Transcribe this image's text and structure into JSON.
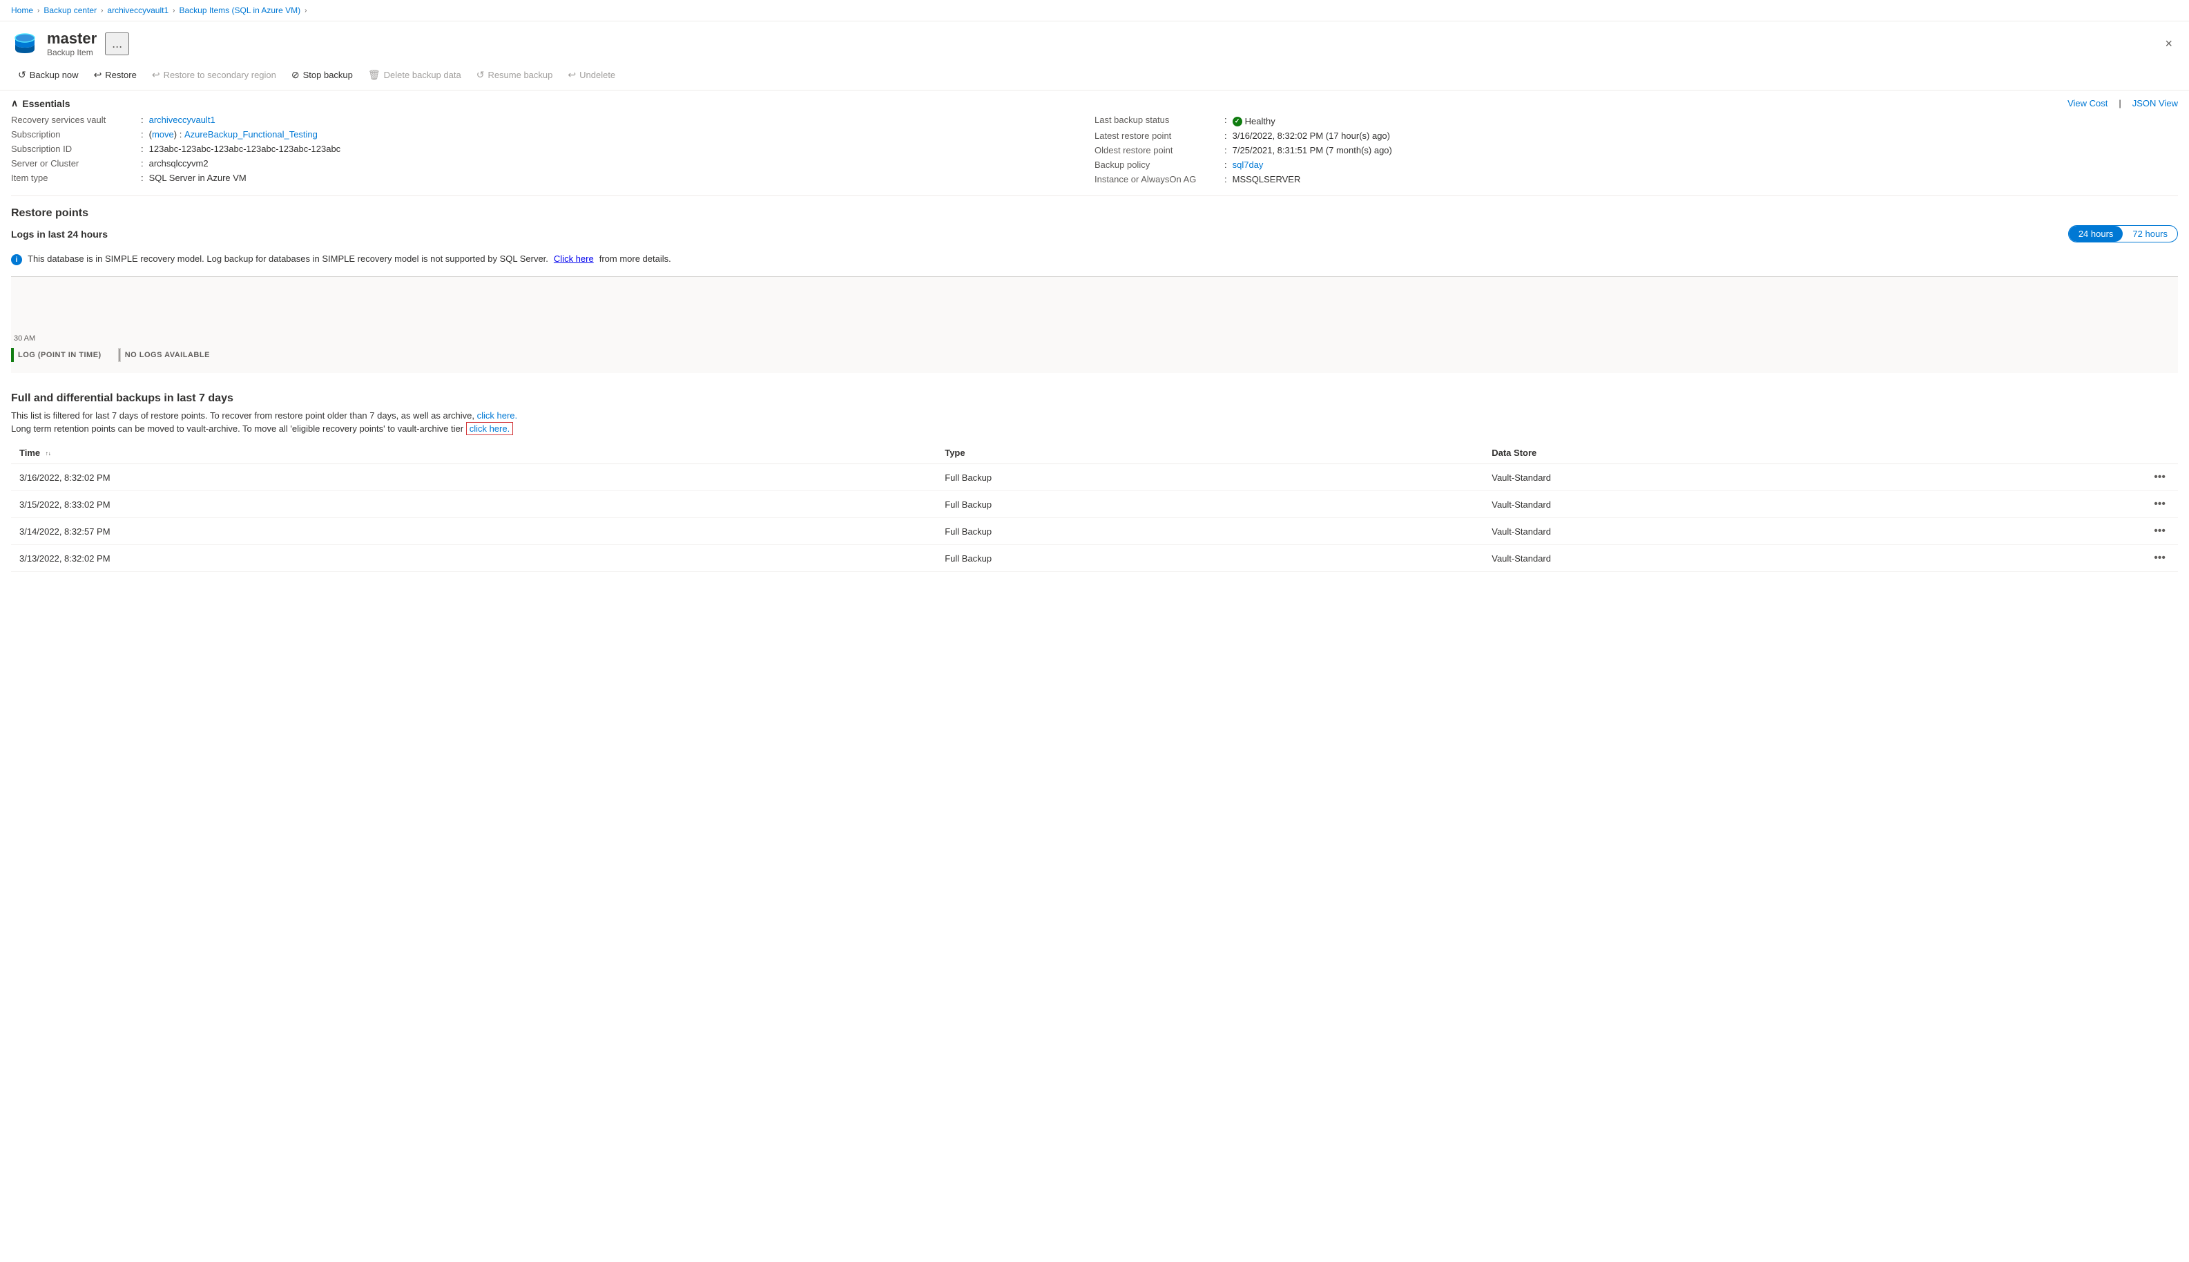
{
  "breadcrumb": {
    "items": [
      {
        "label": "Home",
        "href": "#"
      },
      {
        "label": "Backup center",
        "href": "#"
      },
      {
        "label": "archiveccyvault1",
        "href": "#"
      },
      {
        "label": "Backup Items (SQL in Azure VM)",
        "href": "#"
      }
    ]
  },
  "header": {
    "title": "master",
    "subtitle": "Backup Item",
    "menu_label": "...",
    "close_label": "×"
  },
  "toolbar": {
    "buttons": [
      {
        "label": "Backup now",
        "icon": "backup-icon",
        "disabled": false
      },
      {
        "label": "Restore",
        "icon": "restore-icon",
        "disabled": false
      },
      {
        "label": "Restore to secondary region",
        "icon": "restore-secondary-icon",
        "disabled": true
      },
      {
        "label": "Stop backup",
        "icon": "stop-icon",
        "disabled": false
      },
      {
        "label": "Delete backup data",
        "icon": "delete-icon",
        "disabled": true
      },
      {
        "label": "Resume backup",
        "icon": "resume-icon",
        "disabled": true
      },
      {
        "label": "Undelete",
        "icon": "undelete-icon",
        "disabled": true
      }
    ]
  },
  "essentials": {
    "title": "Essentials",
    "view_cost_label": "View Cost",
    "json_view_label": "JSON View",
    "left": [
      {
        "label": "Recovery services vault",
        "value": "archiveccyvault1",
        "link": true
      },
      {
        "label": "Subscription",
        "value": "AzureBackup_Functional_Testing",
        "link": true,
        "move_label": "move"
      },
      {
        "label": "Subscription ID",
        "value": "123abc-123abc-123abc-123abc-123abc-123abc"
      },
      {
        "label": "Server or Cluster",
        "value": "archsqlccyvm2"
      },
      {
        "label": "Item type",
        "value": "SQL Server in Azure VM"
      }
    ],
    "right": [
      {
        "label": "Last backup status",
        "value": "Healthy",
        "status": true
      },
      {
        "label": "Latest restore point",
        "value": "3/16/2022, 8:32:02 PM (17 hour(s) ago)"
      },
      {
        "label": "Oldest restore point",
        "value": "7/25/2021, 8:31:51 PM (7 month(s) ago)"
      },
      {
        "label": "Backup policy",
        "value": "sql7day",
        "link": true
      },
      {
        "label": "Instance or AlwaysOn AG",
        "value": "MSSQLSERVER"
      }
    ]
  },
  "restore_points": {
    "title": "Restore points",
    "logs_section": {
      "title": "Logs in last 24 hours",
      "toggle_24h": "24 hours",
      "toggle_72h": "72 hours"
    },
    "info_message": "This database is in SIMPLE recovery model. Log backup for databases in SIMPLE recovery model is not supported by SQL Server.",
    "info_link": "Click here",
    "timeline_label": "30 AM",
    "legend": [
      {
        "label": "LOG (POINT IN TIME)",
        "color": "green"
      },
      {
        "label": "NO LOGS AVAILABLE",
        "color": "gray"
      }
    ]
  },
  "full_backups": {
    "title": "Full and differential backups in last 7 days",
    "desc1_prefix": "This list is filtered for last 7 days of restore points. To recover from restore point older than 7 days, as well as archive,",
    "desc1_link": "click here.",
    "desc2_prefix": "Long term retention points can be moved to vault-archive. To move all 'eligible recovery points' to vault-archive tier",
    "desc2_link": "click here.",
    "table": {
      "columns": [
        "Time",
        "Type",
        "Data Store"
      ],
      "rows": [
        {
          "time": "3/16/2022, 8:32:02 PM",
          "type": "Full Backup",
          "datastore": "Vault-Standard"
        },
        {
          "time": "3/15/2022, 8:33:02 PM",
          "type": "Full Backup",
          "datastore": "Vault-Standard"
        },
        {
          "time": "3/14/2022, 8:32:57 PM",
          "type": "Full Backup",
          "datastore": "Vault-Standard"
        },
        {
          "time": "3/13/2022, 8:32:02 PM",
          "type": "Full Backup",
          "datastore": "Vault-Standard"
        }
      ]
    }
  }
}
